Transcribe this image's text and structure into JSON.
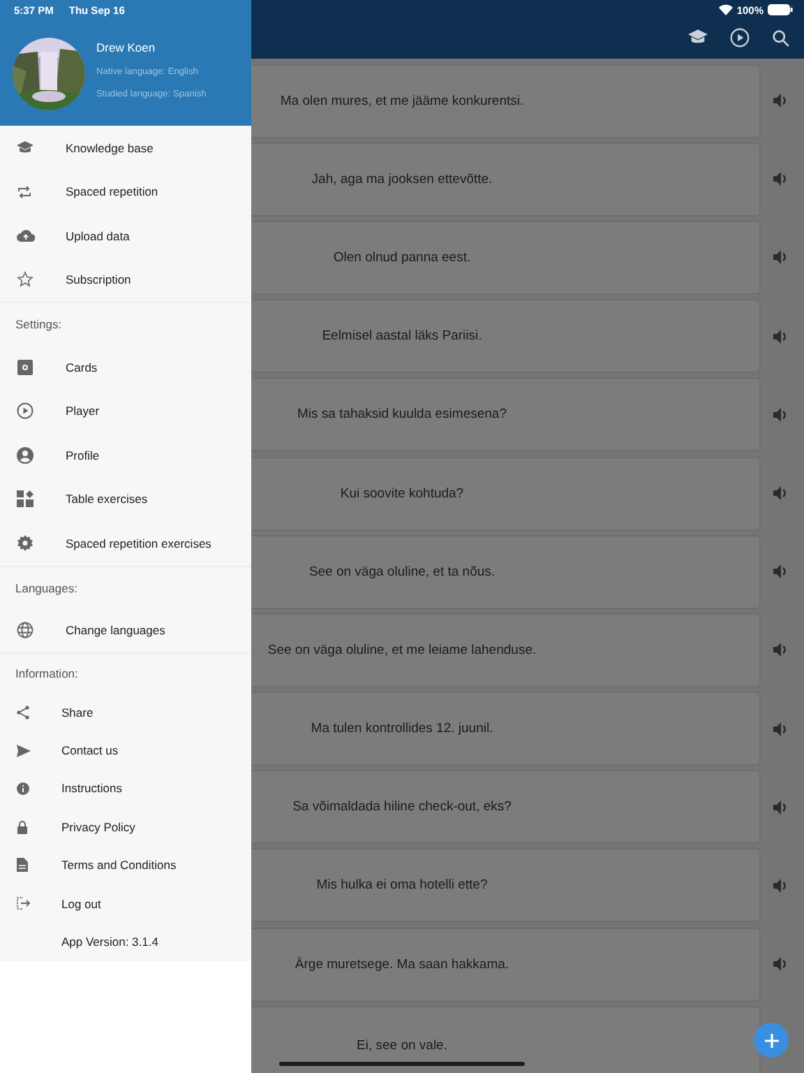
{
  "status_bar": {
    "time": "5:37 PM",
    "date": "Thu Sep 16",
    "battery": "100%"
  },
  "drawer": {
    "profile": {
      "name": "Drew Koen",
      "native_language": "Native language: English",
      "studied_language": "Studied language: Spanish"
    },
    "sections": [
      {
        "items": [
          {
            "label": "Knowledge base"
          },
          {
            "label": "Spaced repetition"
          },
          {
            "label": "Upload data"
          },
          {
            "label": "Subscription"
          }
        ]
      },
      {
        "heading": "Settings:",
        "items": [
          {
            "label": "Cards"
          },
          {
            "label": "Player"
          },
          {
            "label": "Profile"
          },
          {
            "label": "Table exercises"
          },
          {
            "label": "Spaced repetition exercises"
          }
        ]
      },
      {
        "heading": "Languages:",
        "items": [
          {
            "label": "Change languages"
          }
        ]
      },
      {
        "heading": "Information:",
        "items": [
          {
            "label": "Share"
          },
          {
            "label": "Contact us"
          },
          {
            "label": "Instructions"
          },
          {
            "label": "Privacy Policy"
          },
          {
            "label": "Terms and Conditions"
          },
          {
            "label": "Log out"
          }
        ]
      }
    ],
    "app_version": "App Version: 3.1.4"
  },
  "cards": [
    {
      "text": "Ma olen mures, et me jääme konkurentsi."
    },
    {
      "text": "Jah, aga ma jooksen ettevõtte."
    },
    {
      "text": "Olen olnud panna eest."
    },
    {
      "text": "Eelmisel aastal läks Pariisi."
    },
    {
      "text": "Mis sa tahaksid kuulda esimesena?"
    },
    {
      "text": "Kui soovite kohtuda?"
    },
    {
      "text": "See on väga oluline, et ta nõus."
    },
    {
      "text": "See on väga oluline, et me leiame lahenduse."
    },
    {
      "text": "Ma tulen kontrollides 12. juunil."
    },
    {
      "text": "Sa võimaldada hiline check-out, eks?"
    },
    {
      "text": "Mis hulka ei oma hotelli ette?"
    },
    {
      "text": "Ärge muretsege. Ma saan hakkama."
    },
    {
      "text": "Ei, see on vale."
    }
  ]
}
